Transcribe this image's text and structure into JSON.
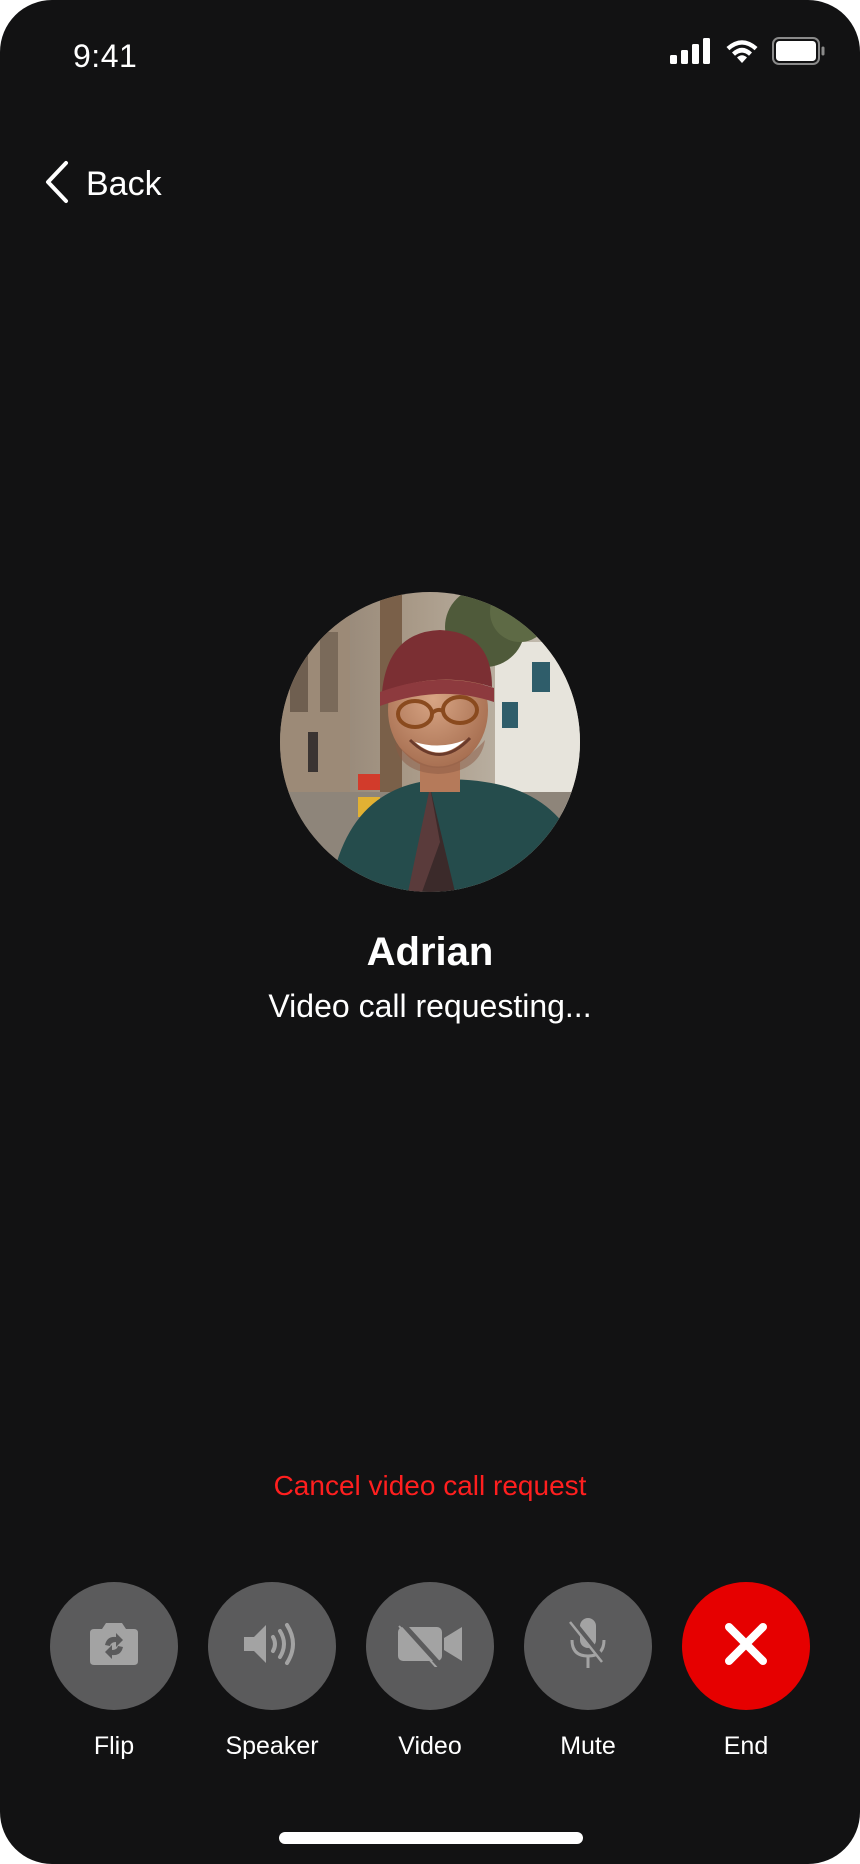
{
  "status_bar": {
    "time": "9:41",
    "signal_icon": "cellular-signal-icon",
    "wifi_icon": "wifi-icon",
    "battery_icon": "battery-icon"
  },
  "nav": {
    "back_label": "Back",
    "back_icon": "chevron-left-icon"
  },
  "caller": {
    "name": "Adrian",
    "status": "Video call requesting...",
    "avatar": "caller-avatar-photo"
  },
  "cancel_link": "Cancel video call request",
  "controls": [
    {
      "label": "Flip",
      "icon": "camera-flip-icon"
    },
    {
      "label": "Speaker",
      "icon": "speaker-icon"
    },
    {
      "label": "Video",
      "icon": "video-off-icon"
    },
    {
      "label": "Mute",
      "icon": "mic-off-icon"
    },
    {
      "label": "End",
      "icon": "close-icon"
    }
  ],
  "colors": {
    "background": "#121213",
    "control_bg": "#5b5b5c",
    "end_button": "#e60000",
    "cancel_text": "#ff1f1f",
    "icon_gray": "#a3a3a3"
  }
}
